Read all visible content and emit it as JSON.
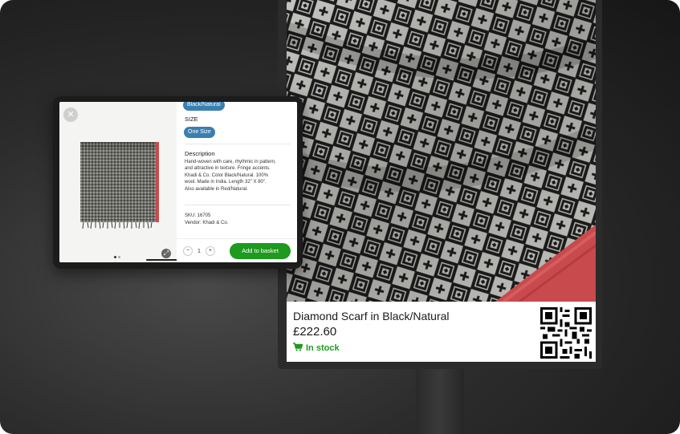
{
  "kiosk": {
    "product_title": "Diamond Scarf in Black/Natural",
    "price": "£222.60",
    "stock_status": "In stock",
    "stock_icon": "cart-icon",
    "qr_icon": "qr-code-icon"
  },
  "tablet": {
    "color_value": "Black/Natural",
    "size_label": "SIZE",
    "size_value": "One Size",
    "description_label": "Description",
    "description_lines": [
      "Hand-woven with care, rhythmic in pattern,",
      "and attractive in texture. Fringe accents.",
      "Khadi & Co. Color Black/Natural. 100%",
      "wool. Made in India. Length 32\" X 80\".",
      "Also available in Red/Natural."
    ],
    "sku": "SKU: 16705",
    "vendor": "Vendor: Khadi & Co.",
    "quantity": "1",
    "minus": "−",
    "plus": "+",
    "add_to_basket": "Add to basket",
    "close_icon": "close-icon",
    "expand_icon": "expand-icon"
  },
  "colors": {
    "accent_green": "#1e9a1e",
    "pill_blue": "#3a7fb0",
    "stock_green": "#1f9a1f"
  }
}
